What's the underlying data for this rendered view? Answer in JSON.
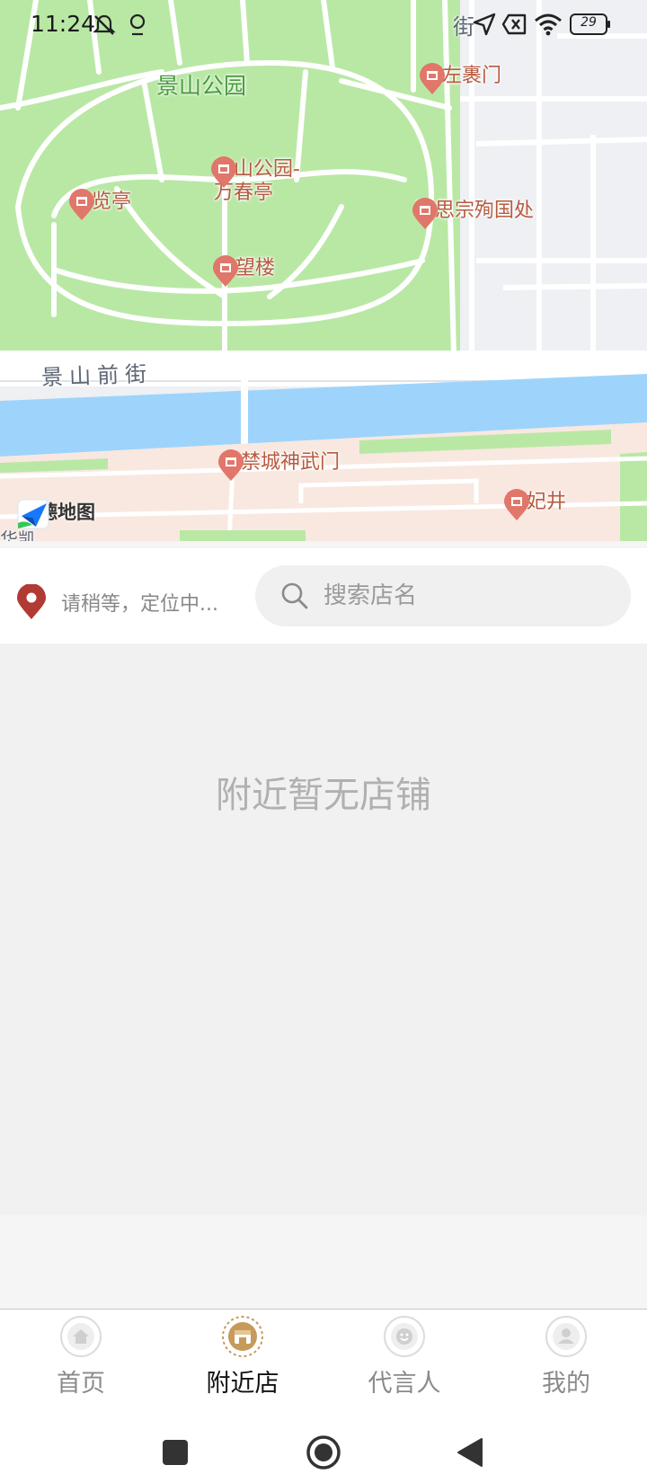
{
  "status_bar": {
    "time": "11:24",
    "battery": "29",
    "icons": [
      "mute-icon",
      "location-icon",
      "navigation-arrow-icon",
      "sim-off-icon",
      "wifi-icon",
      "battery-icon"
    ]
  },
  "map": {
    "park_name": "景山公园",
    "street_name": "景山前街",
    "partial_label_top": "街",
    "partial_label_bottom": "华凯",
    "logo_text": "高德地图",
    "pois": [
      {
        "label": "山左裹门"
      },
      {
        "label": "景山公园-\n万春亭"
      },
      {
        "label": "富览亭"
      },
      {
        "label": "明思宗殉国处"
      },
      {
        "label": "绮望楼"
      },
      {
        "label": "紫禁城神武门"
      },
      {
        "label": "珍妃井"
      }
    ],
    "colors": {
      "park": "#b9e8a5",
      "water": "#9ed4fb",
      "palace": "#f8e8e0",
      "road": "#ffffff",
      "poi": "#e0776a"
    }
  },
  "search_row": {
    "location_text": "请稍等，定位中...",
    "search_placeholder": "搜索店名"
  },
  "content": {
    "empty_message": "附近暂无店铺"
  },
  "tabbar": {
    "tabs": [
      {
        "label": "首页",
        "icon": "home-icon",
        "active": false
      },
      {
        "label": "附近店",
        "icon": "shop-icon",
        "active": true
      },
      {
        "label": "代言人",
        "icon": "smile-icon",
        "active": false
      },
      {
        "label": "我的",
        "icon": "user-icon",
        "active": false
      }
    ],
    "active_color": "#c59a5a"
  },
  "navbar": {
    "icons": [
      "recents-icon",
      "home-circle-icon",
      "back-icon"
    ]
  }
}
